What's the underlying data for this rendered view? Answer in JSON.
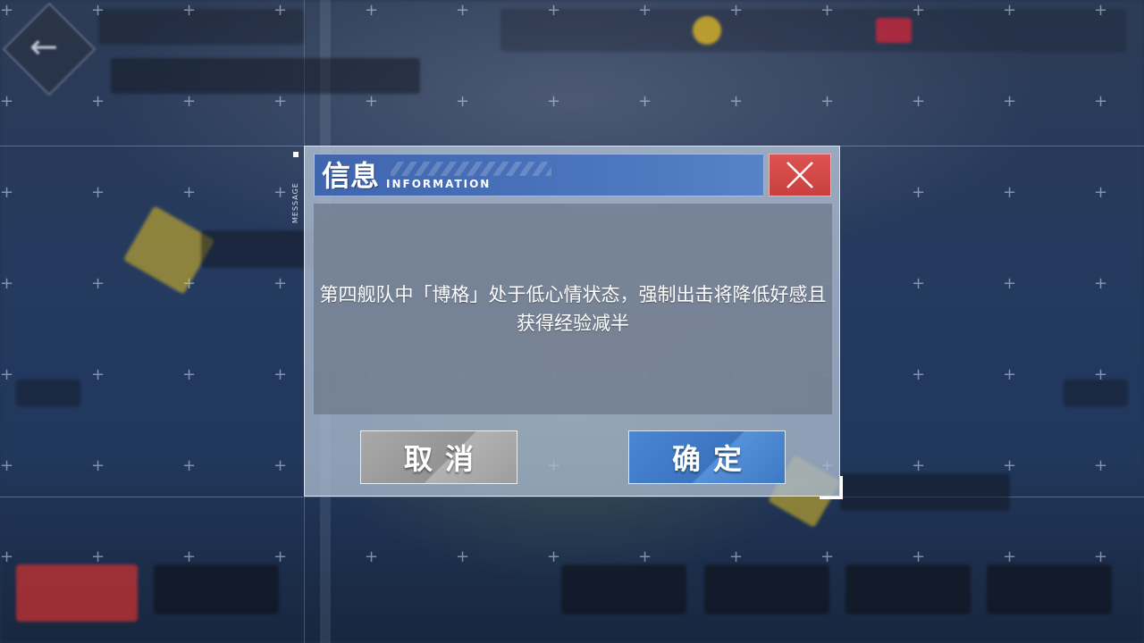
{
  "dialog": {
    "side_tag": "MESSAGE",
    "title_cn": "信息",
    "title_en": "INFORMATION",
    "close_icon": "close-icon",
    "message": "第四舰队中「博格」处于低心情状态，强制出击将降低好感且获得经验减半",
    "cancel_label": "取消",
    "confirm_label": "确定"
  },
  "colors": {
    "title_bar": "#4a74bd",
    "close_button": "#d64b4a",
    "confirm_button": "#4a86d2",
    "cancel_button": "#a3a3a3"
  }
}
